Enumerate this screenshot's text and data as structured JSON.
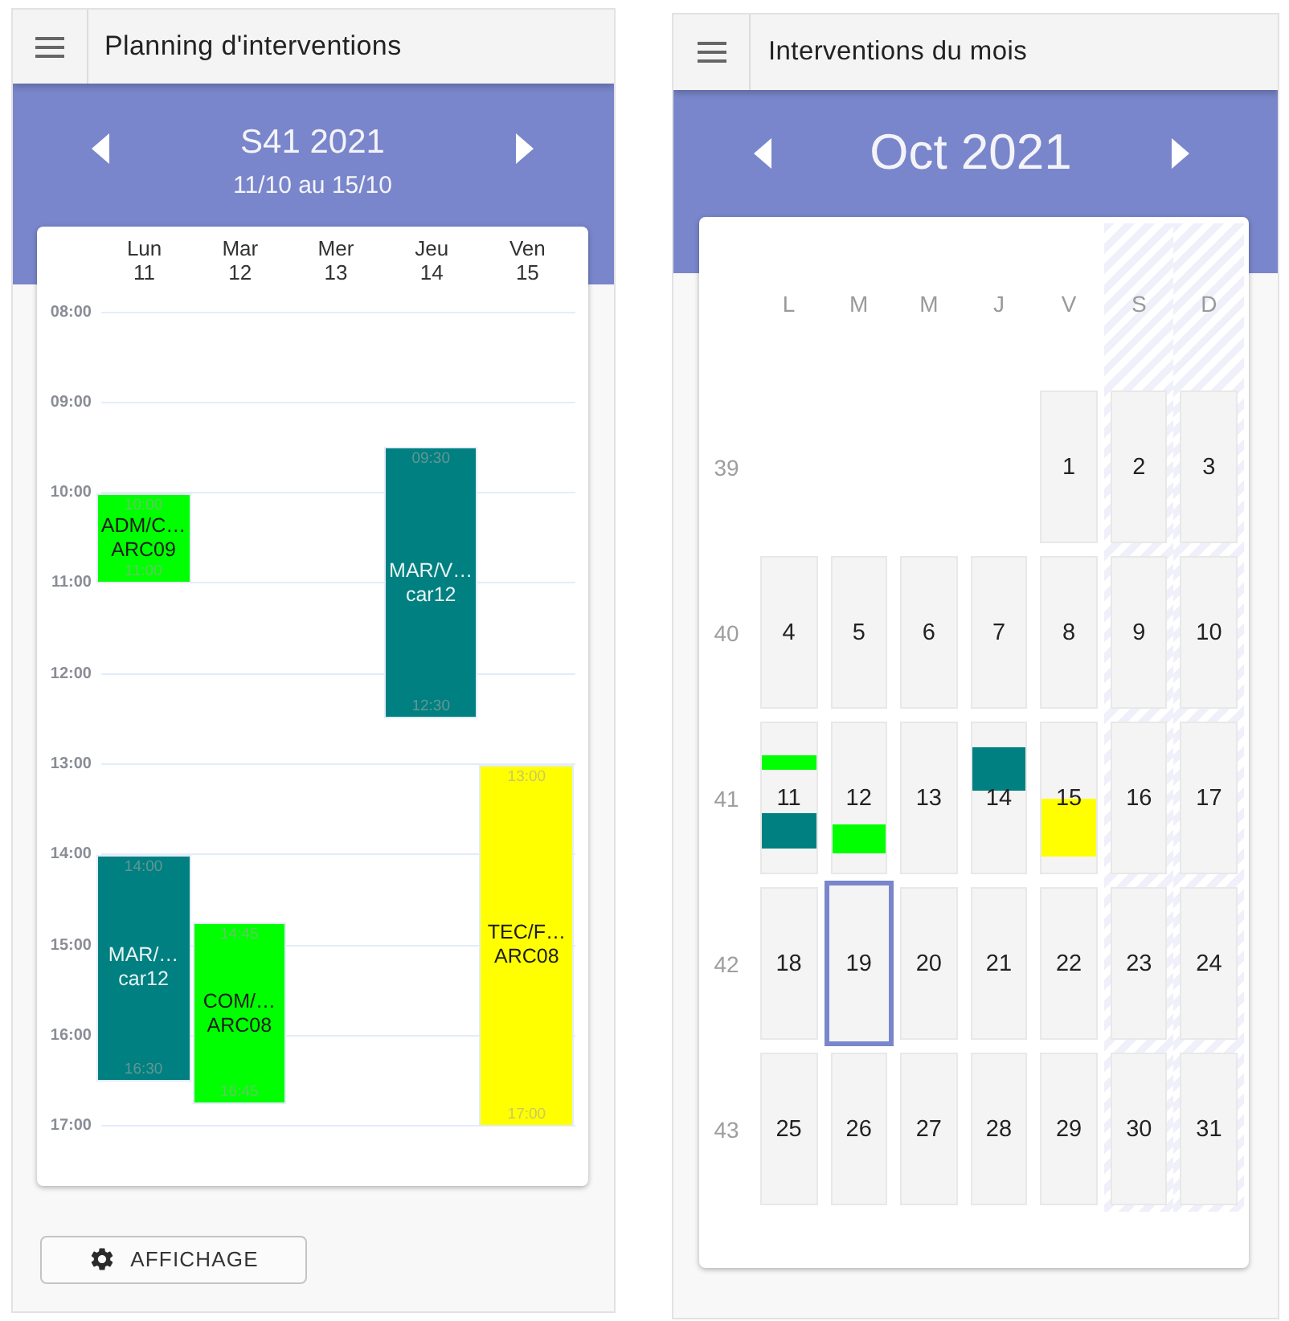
{
  "week_planner": {
    "title": "Planning d'interventions",
    "period": "S41 2021",
    "range": "11/10 au 15/10",
    "hours": [
      "08:00",
      "09:00",
      "10:00",
      "11:00",
      "12:00",
      "13:00",
      "14:00",
      "15:00",
      "16:00",
      "17:00"
    ],
    "days": [
      {
        "name": "Lun",
        "date": "11",
        "events": [
          {
            "title": "ADM/C…",
            "resource": "ARC09",
            "start": "10:00",
            "end": "11:00",
            "color": "#00ff00"
          },
          {
            "title": "MAR/…",
            "resource": "car12",
            "start": "14:00",
            "end": "16:30",
            "color": "#008080"
          }
        ]
      },
      {
        "name": "Mar",
        "date": "12",
        "events": [
          {
            "title": "COM/…",
            "resource": "ARC08",
            "start": "14:45",
            "end": "16:45",
            "color": "#00ff00"
          }
        ]
      },
      {
        "name": "Mer",
        "date": "13"
      },
      {
        "name": "Jeu",
        "date": "14",
        "events": [
          {
            "title": "MAR/V…",
            "resource": "car12",
            "start": "09:30",
            "end": "12:30",
            "color": "#008080"
          }
        ]
      },
      {
        "name": "Ven",
        "date": "15",
        "events": [
          {
            "title": "TEC/F…",
            "resource": "ARC08",
            "start": "13:00",
            "end": "17:00",
            "color": "#ffff00"
          }
        ]
      }
    ],
    "display_button": {
      "label": "AFFICHAGE"
    }
  },
  "month_planner": {
    "title": "Interventions du mois",
    "period": "Oct 2021",
    "weekdays": [
      {
        "label": "L",
        "weekend": false
      },
      {
        "label": "M",
        "weekend": false
      },
      {
        "label": "M",
        "weekend": false
      },
      {
        "label": "J",
        "weekend": false
      },
      {
        "label": "V",
        "weekend": false
      },
      {
        "label": "S",
        "weekend": true
      },
      {
        "label": "D",
        "weekend": true
      }
    ],
    "weeks": [
      {
        "number": "39",
        "days": [
          {
            "date": "1",
            "selected": false
          },
          {
            "date": "2",
            "selected": false
          },
          {
            "date": "3",
            "selected": false
          }
        ]
      },
      {
        "number": "40",
        "days": [
          {
            "date": "4",
            "selected": false
          },
          {
            "date": "5",
            "selected": false
          },
          {
            "date": "6",
            "selected": false
          },
          {
            "date": "7",
            "selected": false
          },
          {
            "date": "8",
            "selected": false
          },
          {
            "date": "9",
            "selected": false
          },
          {
            "date": "10",
            "selected": false
          }
        ]
      },
      {
        "number": "41",
        "days": [
          {
            "date": "11",
            "selected": false,
            "events": [
              {
                "color": "#00ff00"
              },
              {
                "color": "#008080"
              }
            ]
          },
          {
            "date": "12",
            "selected": false,
            "events": [
              {
                "color": "#00ff00"
              }
            ]
          },
          {
            "date": "13",
            "selected": false
          },
          {
            "date": "14",
            "selected": false,
            "events": [
              {
                "color": "#008080"
              }
            ]
          },
          {
            "date": "15",
            "selected": false,
            "events": [
              {
                "color": "#ffff00"
              }
            ]
          },
          {
            "date": "16",
            "selected": false
          },
          {
            "date": "17",
            "selected": false
          }
        ]
      },
      {
        "number": "42",
        "days": [
          {
            "date": "18",
            "selected": false
          },
          {
            "date": "19",
            "selected": true
          },
          {
            "date": "20",
            "selected": false
          },
          {
            "date": "21",
            "selected": false
          },
          {
            "date": "22",
            "selected": false
          },
          {
            "date": "23",
            "selected": false
          },
          {
            "date": "24",
            "selected": false
          }
        ]
      },
      {
        "number": "43",
        "days": [
          {
            "date": "25",
            "selected": false
          },
          {
            "date": "26",
            "selected": false
          },
          {
            "date": "27",
            "selected": false
          },
          {
            "date": "28",
            "selected": false
          },
          {
            "date": "29",
            "selected": false
          },
          {
            "date": "30",
            "selected": false
          },
          {
            "date": "31",
            "selected": false
          }
        ]
      }
    ]
  }
}
